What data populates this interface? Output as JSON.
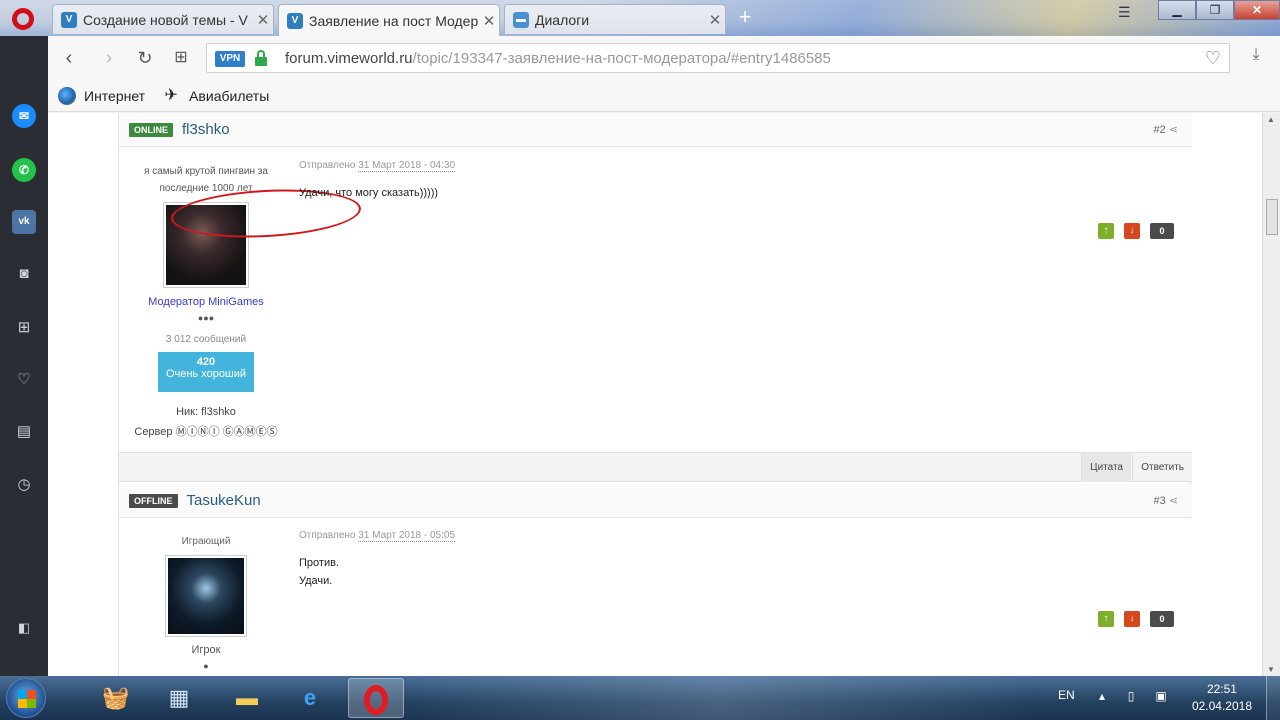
{
  "browser": {
    "tabs": [
      {
        "label": "Создание новой темы - V"
      },
      {
        "label": "Заявление на пост Модер"
      },
      {
        "label": "Диалоги"
      }
    ],
    "new_tab": "+",
    "vpn": "VPN",
    "url_domain": "forum.vimeworld.ru",
    "url_path": "/topic/193347-заявление-на-пост-модератора/#entry1486585"
  },
  "bookmarks": [
    {
      "label": "Интернет"
    },
    {
      "label": "Авиабилеты"
    }
  ],
  "posts": [
    {
      "status": "ONLINE",
      "username": "fl3shko",
      "number": "#2",
      "title_text": "я самый крутой пингвин за последние 1000 лет",
      "group": "Модератор MiniGames",
      "pips": "●●●",
      "messages": "3 012 сообщений",
      "rep_value": "420",
      "rep_label": "Очень хороший",
      "nick": "Ник: fl3shko",
      "server": "Сервер ⓂⒾⓃⒾ ⒼⒶⓂⒺⓈ",
      "date_prefix": "Отправлено",
      "date": "31 Март 2018 - 04:30",
      "lines": [
        "Удачи, что могу сказать)))))"
      ],
      "rating": "0",
      "quote": "Цитата",
      "reply": "Ответить"
    },
    {
      "status": "OFFLINE",
      "username": "TasukeKun",
      "number": "#3",
      "title_text": "Играющий",
      "group": "Игрок",
      "pips": "●",
      "date_prefix": "Отправлено",
      "date": "31 Март 2018 - 05:05",
      "lines": [
        "Против.",
        "Удачи."
      ],
      "rating": "0"
    }
  ],
  "taskbar": {
    "lang": "EN",
    "time": "22:51",
    "date": "02.04.2018"
  },
  "colors": {
    "online": "#3c8b3c",
    "offline": "#4b4b4b",
    "username": "#2a5b85",
    "group_link": "#3a3ad0",
    "rep": "#43b5dc",
    "vote_up": "#7fae2d",
    "vote_down": "#d4481c",
    "annotation_circle": "#d0181c"
  }
}
